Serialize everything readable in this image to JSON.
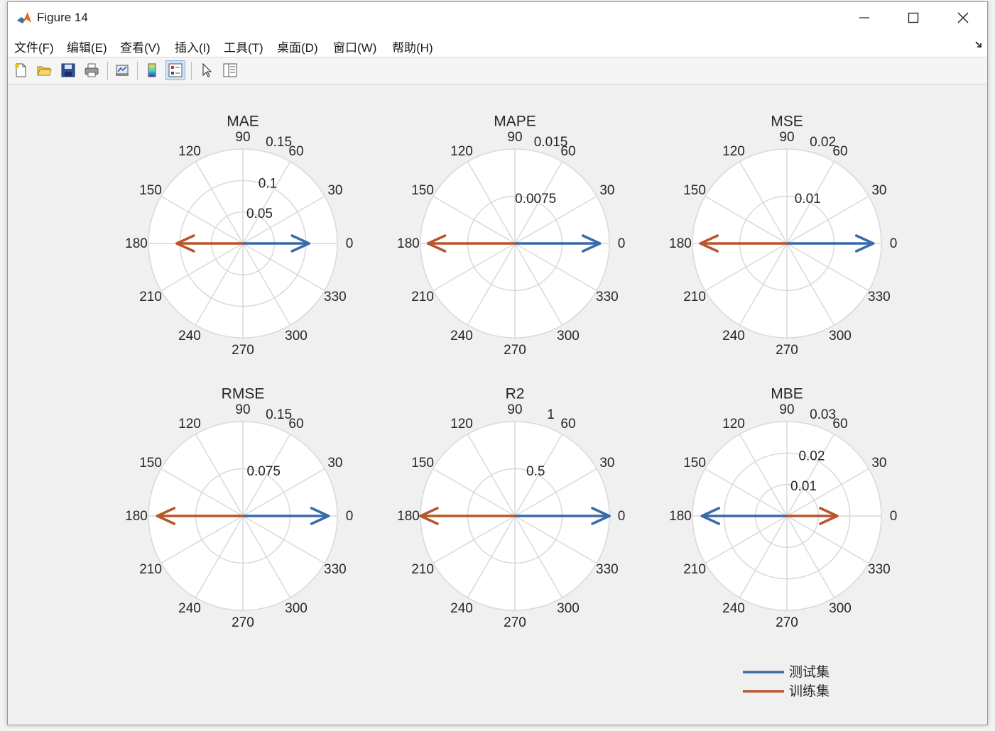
{
  "window": {
    "title": "Figure 14",
    "controls": {
      "minimize": "minimize",
      "maximize": "maximize",
      "close": "close"
    }
  },
  "menubar": {
    "items": [
      "文件(F)",
      "编辑(E)",
      "查看(V)",
      "插入(I)",
      "工具(T)",
      "桌面(D)",
      "窗口(W)",
      "帮助(H)"
    ]
  },
  "toolbar": {
    "buttons": [
      {
        "icon": "new-figure-icon"
      },
      {
        "icon": "open-folder-icon"
      },
      {
        "icon": "save-icon"
      },
      {
        "icon": "print-icon"
      },
      {
        "icon": "link-plot-icon"
      },
      {
        "icon": "colorbar-icon"
      },
      {
        "icon": "legend-icon",
        "active": true
      },
      {
        "icon": "pointer-icon"
      },
      {
        "icon": "property-inspector-icon"
      }
    ]
  },
  "colors": {
    "test": "#3a6aa8",
    "train": "#b8552a",
    "grid": "#d9d9d9"
  },
  "chart_data": [
    {
      "type": "polar-compass",
      "title": "MAE",
      "rlim": [
        0,
        0.15
      ],
      "rticks": [
        "0.05",
        "0.1",
        "0.15"
      ],
      "theta_ticks": [
        "0",
        "30",
        "60",
        "90",
        "120",
        "150",
        "180",
        "210",
        "240",
        "270",
        "300",
        "330"
      ],
      "series": [
        {
          "name": "测试集",
          "value": 0.105,
          "angle": 0
        },
        {
          "name": "训练集",
          "value": 0.105,
          "angle": 180
        }
      ]
    },
    {
      "type": "polar-compass",
      "title": "MAPE",
      "rlim": [
        0,
        0.015
      ],
      "rticks": [
        "0.0075",
        "0.015"
      ],
      "theta_ticks": [
        "0",
        "30",
        "60",
        "90",
        "120",
        "150",
        "180",
        "210",
        "240",
        "270",
        "300",
        "330"
      ],
      "series": [
        {
          "name": "测试集",
          "value": 0.0135,
          "angle": 0
        },
        {
          "name": "训练集",
          "value": 0.0138,
          "angle": 180
        }
      ]
    },
    {
      "type": "polar-compass",
      "title": "MSE",
      "rlim": [
        0,
        0.02
      ],
      "rticks": [
        "0.01",
        "0.02"
      ],
      "theta_ticks": [
        "0",
        "30",
        "60",
        "90",
        "120",
        "150",
        "180",
        "210",
        "240",
        "270",
        "300",
        "330"
      ],
      "series": [
        {
          "name": "测试集",
          "value": 0.0183,
          "angle": 0
        },
        {
          "name": "训练集",
          "value": 0.0183,
          "angle": 180
        }
      ]
    },
    {
      "type": "polar-compass",
      "title": "RMSE",
      "rlim": [
        0,
        0.15
      ],
      "rticks": [
        "0.075",
        "0.15"
      ],
      "theta_ticks": [
        "0",
        "30",
        "60",
        "90",
        "120",
        "150",
        "180",
        "210",
        "240",
        "270",
        "300",
        "330"
      ],
      "series": [
        {
          "name": "测试集",
          "value": 0.136,
          "angle": 0
        },
        {
          "name": "训练集",
          "value": 0.136,
          "angle": 180
        }
      ]
    },
    {
      "type": "polar-compass",
      "title": "R2",
      "rlim": [
        0,
        1
      ],
      "rticks": [
        "0.5",
        "1"
      ],
      "theta_ticks": [
        "0",
        "30",
        "60",
        "90",
        "120",
        "150",
        "180",
        "210",
        "240",
        "270",
        "300",
        "330"
      ],
      "series": [
        {
          "name": "测试集",
          "value": 1.0,
          "angle": 0
        },
        {
          "name": "训练集",
          "value": 1.0,
          "angle": 180
        }
      ]
    },
    {
      "type": "polar-compass",
      "title": "MBE",
      "rlim": [
        0,
        0.03
      ],
      "rticks": [
        "0.01",
        "0.02",
        "0.03"
      ],
      "theta_ticks": [
        "0",
        "30",
        "60",
        "90",
        "120",
        "150",
        "180",
        "210",
        "240",
        "270",
        "300",
        "330"
      ],
      "series": [
        {
          "name": "测试集",
          "value": 0.027,
          "angle": 180
        },
        {
          "name": "训练集",
          "value": 0.016,
          "angle": 0
        }
      ]
    }
  ],
  "legend": {
    "placement": "bottom-right",
    "items": [
      "测试集",
      "训练集"
    ]
  }
}
